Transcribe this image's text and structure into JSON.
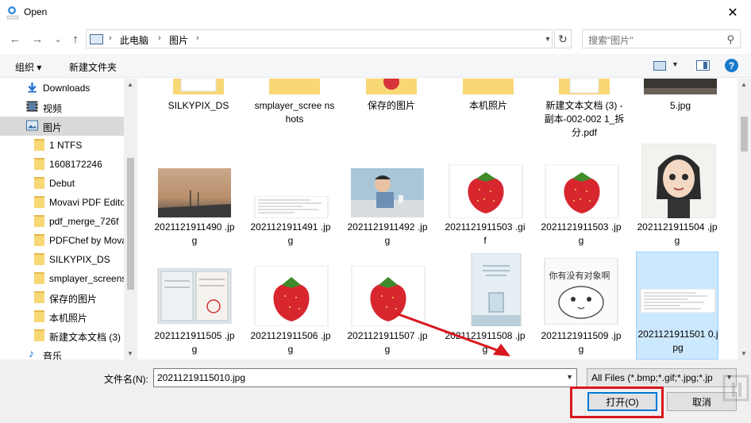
{
  "window": {
    "title": "Open",
    "close_glyph": "✕"
  },
  "nav": {
    "back_glyph": "←",
    "forward_glyph": "→",
    "recent_glyph": "⌄",
    "up_glyph": "↑",
    "breadcrumb": [
      "此电脑",
      "图片"
    ],
    "refresh_glyph": "↻",
    "search_placeholder": "搜索\"图片\""
  },
  "toolbar": {
    "organize_label": "组织 ▾",
    "new_folder_label": "新建文件夹",
    "help_glyph": "?"
  },
  "sidebar": {
    "items": [
      {
        "label": "Downloads",
        "icon": "download-arrow-icon"
      },
      {
        "label": "视频",
        "icon": "video-icon"
      },
      {
        "label": "图片",
        "icon": "pictures-icon",
        "selected": true
      },
      {
        "label": "1 NTFS",
        "icon": "folder-icon"
      },
      {
        "label": "1608172246",
        "icon": "folder-icon"
      },
      {
        "label": "Debut",
        "icon": "folder-icon"
      },
      {
        "label": "Movavi PDF Editor",
        "icon": "folder-icon"
      },
      {
        "label": "pdf_merge_726f",
        "icon": "folder-icon"
      },
      {
        "label": "PDFChef by Movavi",
        "icon": "folder-icon"
      },
      {
        "label": "SILKYPIX_DS",
        "icon": "folder-icon"
      },
      {
        "label": "smplayer_screenshots",
        "icon": "folder-icon"
      },
      {
        "label": "保存的图片",
        "icon": "folder-icon"
      },
      {
        "label": "本机照片",
        "icon": "folder-icon"
      },
      {
        "label": "新建文本文档 (3)",
        "icon": "folder-icon"
      },
      {
        "label": "音乐",
        "icon": "music-icon"
      }
    ]
  },
  "files": {
    "row1": [
      {
        "name": "SILKYPIX_DS",
        "kind": "folder"
      },
      {
        "name": "smplayer_scree nshots",
        "kind": "folder"
      },
      {
        "name": "保存的图片",
        "kind": "folder"
      },
      {
        "name": "本机照片",
        "kind": "folder"
      },
      {
        "name": "新建文本文档 (3) - 副本-002-002 1_拆分.pdf",
        "kind": "pdf"
      },
      {
        "name": "5.jpg",
        "kind": "image"
      }
    ],
    "row2": [
      {
        "name": "2021121911490 .jpg",
        "kind": "landscape"
      },
      {
        "name": "2021121911491 .jpg",
        "kind": "document"
      },
      {
        "name": "2021121911492 .jpg",
        "kind": "person"
      },
      {
        "name": "2021121911503 .gif",
        "kind": "strawberry"
      },
      {
        "name": "2021121911503 .jpg",
        "kind": "strawberry"
      },
      {
        "name": "2021121911504 .jpg",
        "kind": "cartoon"
      }
    ],
    "row3": [
      {
        "name": "2021121911505 .jpg",
        "kind": "certificate"
      },
      {
        "name": "2021121911506 .jpg",
        "kind": "strawberry"
      },
      {
        "name": "2021121911507 .jpg",
        "kind": "strawberry"
      },
      {
        "name": "2021121911508 .jpg",
        "kind": "poster"
      },
      {
        "name": "2021121911509 .jpg",
        "kind": "meme",
        "meme_text": "你有没有对象啊"
      },
      {
        "name": "2021121911501 0.jpg",
        "kind": "document",
        "selected": true
      }
    ]
  },
  "bottom": {
    "filename_label": "文件名(N):",
    "filename_value": "20211219115010.jpg",
    "filter_value": "All Files (*.bmp;*.gif;*.jpg;*.jp",
    "open_label": "打开(O)",
    "cancel_label": "取消"
  },
  "colors": {
    "selection": "#cce8ff",
    "accent": "#0078d7",
    "highlight_red": "#d8181f",
    "folder": "#f8d775"
  }
}
